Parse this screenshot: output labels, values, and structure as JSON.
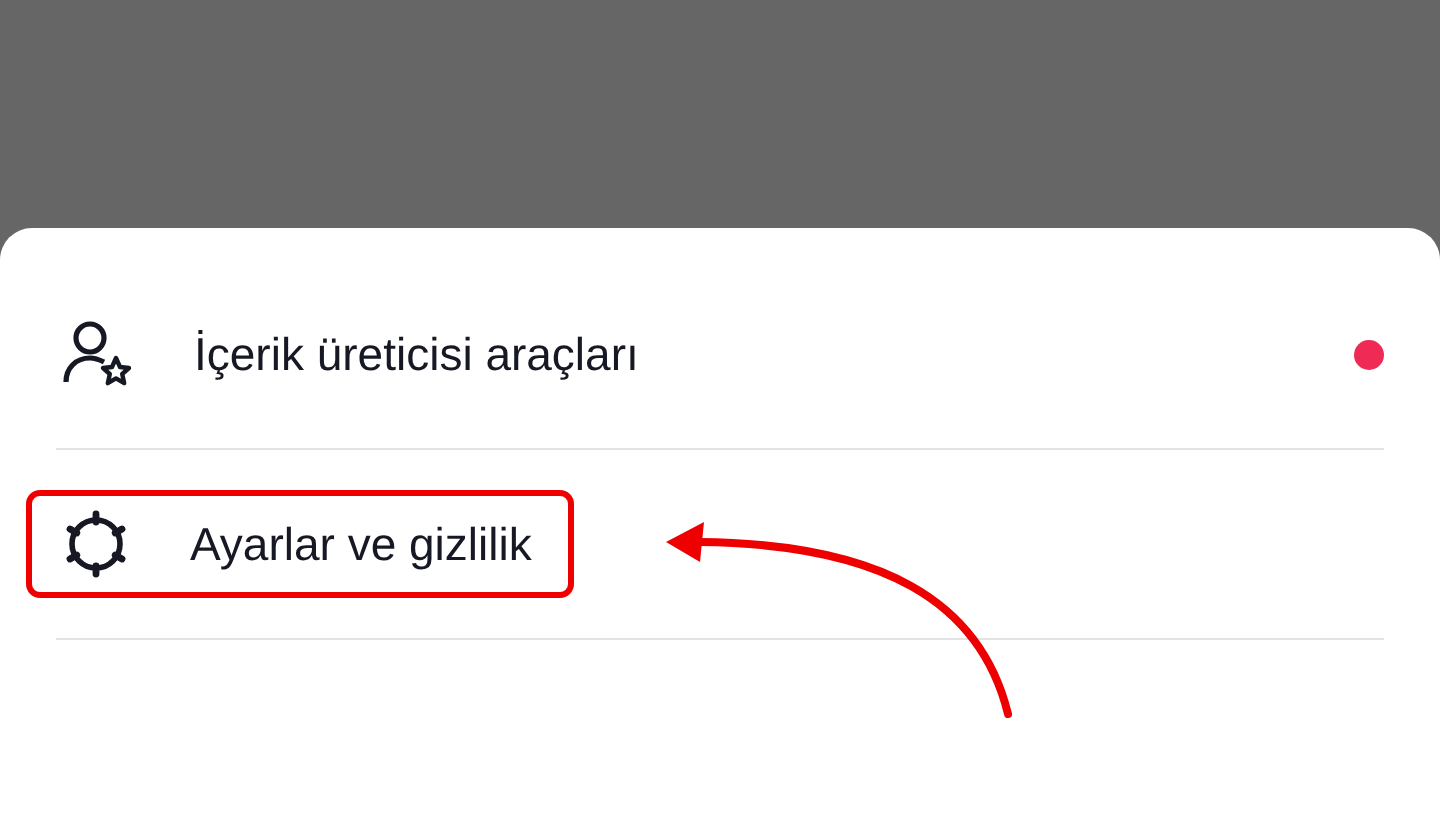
{
  "menu": {
    "items": [
      {
        "kind": "creator",
        "label": "İçerik üreticisi araçları",
        "color": "#ee2a55",
        "highlighted": false
      },
      {
        "kind": "settings",
        "label": "Ayarlar ve gizlilik",
        "highlighted": true
      }
    ]
  }
}
